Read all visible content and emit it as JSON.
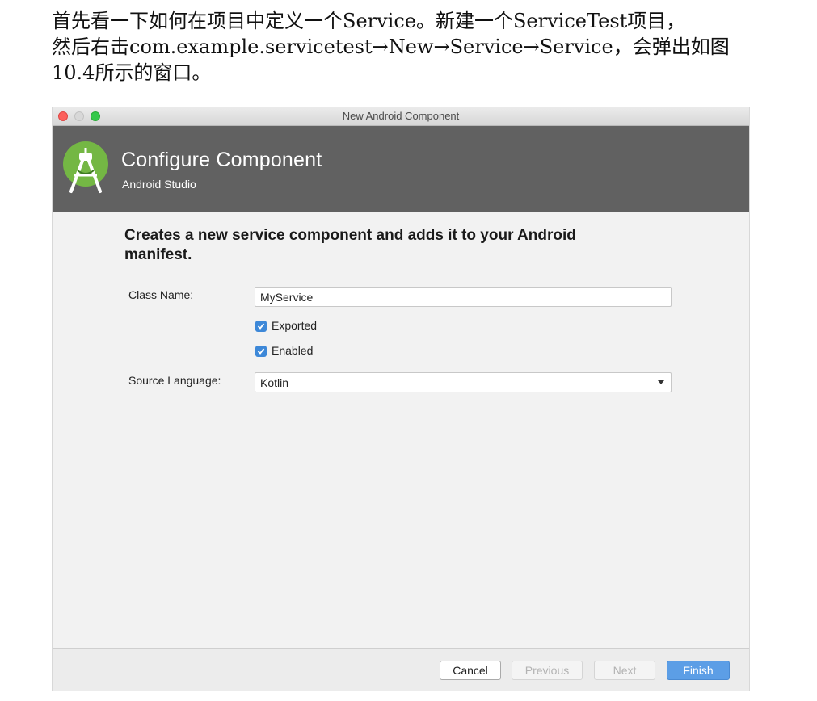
{
  "document": {
    "line1": "首先看一下如何在项目中定义一个Service。新建一个ServiceTest项目，",
    "line2": "然后右击com.example.servicetest→New→Service→Service，会弹出如图",
    "line3": "10.4所示的窗口。"
  },
  "window": {
    "title": "New Android Component"
  },
  "banner": {
    "title": "Configure Component",
    "subtitle": "Android Studio",
    "logo_icon": "android-studio-logo-icon",
    "logo_color": "#74b744"
  },
  "form": {
    "heading": "Creates a new service component and adds it to your Android manifest.",
    "class_name_label": "Class Name:",
    "class_name_value": "MyService",
    "exported_label": "Exported",
    "exported_checked": true,
    "enabled_label": "Enabled",
    "enabled_checked": true,
    "source_language_label": "Source Language:",
    "source_language_value": "Kotlin"
  },
  "footer": {
    "cancel_label": "Cancel",
    "previous_label": "Previous",
    "next_label": "Next",
    "finish_label": "Finish",
    "accent_color": "#5c9ee6"
  }
}
